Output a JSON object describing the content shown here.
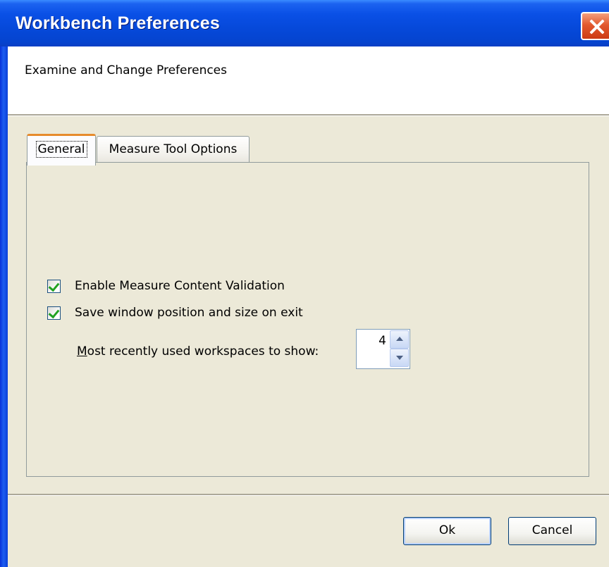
{
  "window": {
    "title": "Workbench Preferences",
    "close_icon": "close-icon"
  },
  "header": {
    "description": "Examine and Change Preferences"
  },
  "tabs": [
    {
      "label": "General",
      "selected": true
    },
    {
      "label": "Measure Tool Options",
      "selected": false
    }
  ],
  "general": {
    "enable_validation": {
      "label": "Enable Measure Content Validation",
      "checked": true
    },
    "save_window": {
      "label": "Save window position and size on exit",
      "checked": true
    },
    "mru": {
      "label_first": "M",
      "label_rest": "ost recently used workspaces to show:",
      "value": "4"
    }
  },
  "footer": {
    "ok_label": "Ok",
    "cancel_label": "Cancel"
  },
  "colors": {
    "title_bar": "#0a50e6",
    "tab_highlight": "#e68b2c",
    "check_mark": "#21a121"
  }
}
